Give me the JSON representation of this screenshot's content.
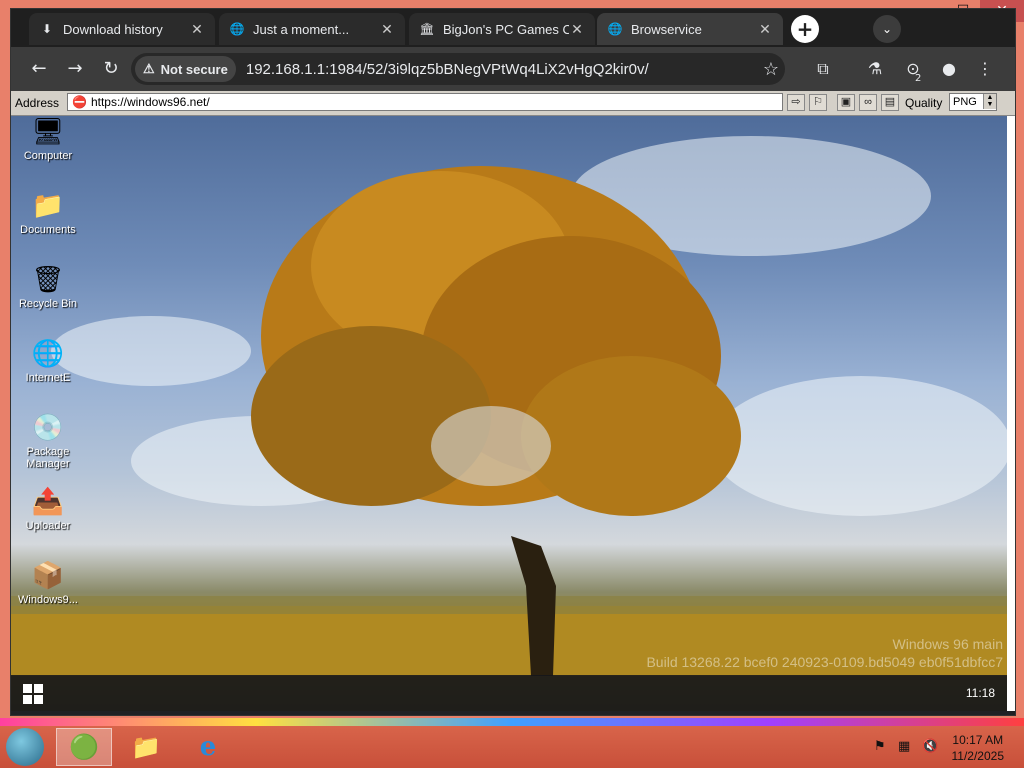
{
  "tabs": [
    {
      "label": "Download history",
      "icon": "download-icon"
    },
    {
      "label": "Just a moment...",
      "icon": "globe-icon"
    },
    {
      "label": "BigJon's PC Games Co",
      "icon": "building-icon"
    },
    {
      "label": "Browservice",
      "icon": "globe-icon"
    }
  ],
  "toolbar": {
    "security": "Not secure",
    "url": "192.168.1.1:1984/52/3i9lqz5bBNegVPtWq4LiX2vHgQ2kir0v/",
    "download_count": "2"
  },
  "remote_bar": {
    "address_label": "Address",
    "address_value": "https://windows96.net/",
    "quality_label": "Quality",
    "quality_value": "PNG"
  },
  "desktop": {
    "icons": [
      {
        "label": "Computer",
        "icon": "computer-icon"
      },
      {
        "label": "Documents",
        "icon": "folder-icon"
      },
      {
        "label": "Recycle Bin",
        "icon": "recycle-bin-icon"
      },
      {
        "label": "InternetE",
        "icon": "globe-icon"
      },
      {
        "label": "Package Manager",
        "icon": "package-manager-icon"
      },
      {
        "label": "Uploader",
        "icon": "uploader-icon"
      },
      {
        "label": "Windows9...",
        "icon": "box-icon"
      }
    ],
    "watermark_line1": "Windows 96 main",
    "watermark_line2": "Build 13268.22 bcef0 240923-0109.bd5049 eb0f51dbfcc7",
    "clock": "11:18"
  },
  "host_taskbar": {
    "time": "10:17 AM",
    "date": "11/2/2025"
  }
}
